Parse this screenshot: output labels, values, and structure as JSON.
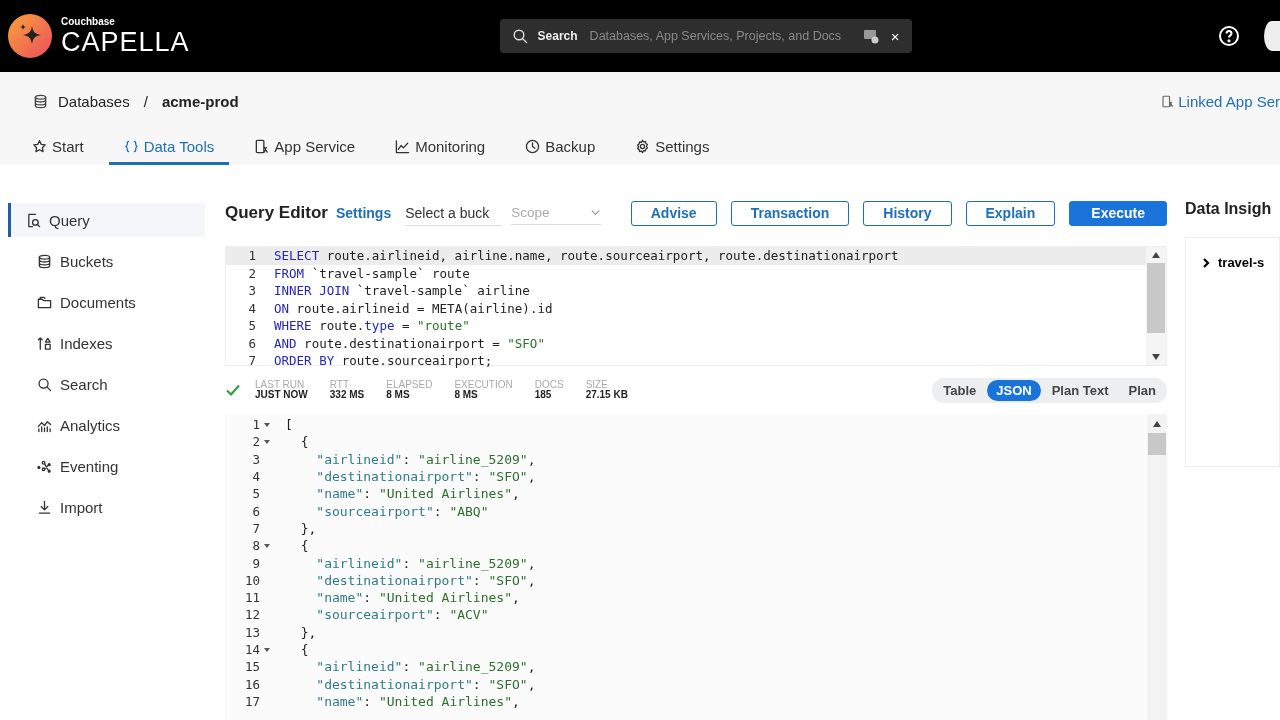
{
  "header": {
    "brand_small": "Couchbase",
    "brand": "CAPELLA",
    "search": {
      "label": "Search",
      "placeholder": "Databases, App Services, Projects, and Docs",
      "close": "×"
    }
  },
  "breadcrumb": {
    "parent": "Databases",
    "separator": "/",
    "current": "acme-prod",
    "link": "Linked App Ser"
  },
  "tabs": [
    {
      "label": "Start",
      "selected": false
    },
    {
      "label": "Data Tools",
      "selected": true
    },
    {
      "label": "App Service",
      "selected": false
    },
    {
      "label": "Monitoring",
      "selected": false
    },
    {
      "label": "Backup",
      "selected": false
    },
    {
      "label": "Settings",
      "selected": false
    }
  ],
  "sidebar": {
    "items": [
      {
        "label": "Query",
        "selected": true
      },
      {
        "label": "Buckets",
        "selected": false
      },
      {
        "label": "Documents",
        "selected": false
      },
      {
        "label": "Indexes",
        "selected": false
      },
      {
        "label": "Search",
        "selected": false
      },
      {
        "label": "Analytics",
        "selected": false
      },
      {
        "label": "Eventing",
        "selected": false
      },
      {
        "label": "Import",
        "selected": false
      }
    ]
  },
  "query_editor": {
    "title": "Query Editor",
    "settings_link": "Settings",
    "bucket_select": "Select a buck",
    "scope_select": "Scope",
    "buttons": [
      {
        "label": "Advise",
        "primary": false
      },
      {
        "label": "Transaction",
        "primary": false
      },
      {
        "label": "History",
        "primary": false
      },
      {
        "label": "Explain",
        "primary": false
      },
      {
        "label": "Execute",
        "primary": true
      }
    ],
    "lines": [
      {
        "number": "1",
        "current": true,
        "tokens": [
          {
            "kind": "keyword",
            "text": "SELECT"
          },
          {
            "kind": "plain",
            "text": " route.airlineid, airline.name, route.sourceairport, route.destinationairport"
          }
        ]
      },
      {
        "number": "2",
        "current": false,
        "tokens": [
          {
            "kind": "keyword",
            "text": "FROM"
          },
          {
            "kind": "plain",
            "text": " `travel-sample` route"
          }
        ]
      },
      {
        "number": "3",
        "current": false,
        "tokens": [
          {
            "kind": "keyword",
            "text": "INNER JOIN"
          },
          {
            "kind": "plain",
            "text": " `travel-sample` airline"
          }
        ]
      },
      {
        "number": "4",
        "current": false,
        "tokens": [
          {
            "kind": "keyword",
            "text": "ON"
          },
          {
            "kind": "plain",
            "text": " route.airlineid = META(airline).id"
          }
        ]
      },
      {
        "number": "5",
        "current": false,
        "tokens": [
          {
            "kind": "keyword",
            "text": "WHERE"
          },
          {
            "kind": "plain",
            "text": " route."
          },
          {
            "kind": "keyword",
            "text": "type"
          },
          {
            "kind": "plain",
            "text": " = "
          },
          {
            "kind": "string",
            "text": "\"route\""
          }
        ]
      },
      {
        "number": "6",
        "current": false,
        "tokens": [
          {
            "kind": "keyword",
            "text": "AND"
          },
          {
            "kind": "plain",
            "text": " route.destinationairport = "
          },
          {
            "kind": "string",
            "text": "\"SFO\""
          }
        ]
      },
      {
        "number": "7",
        "current": false,
        "tokens": [
          {
            "kind": "keyword",
            "text": "ORDER BY"
          },
          {
            "kind": "plain",
            "text": " route.sourceairport;"
          }
        ]
      }
    ]
  },
  "run_status": {
    "success": true,
    "stats": [
      {
        "label": "LAST RUN",
        "value": "JUST NOW"
      },
      {
        "label": "RTT",
        "value": "332 MS"
      },
      {
        "label": "ELAPSED",
        "value": "8 MS"
      },
      {
        "label": "EXECUTION",
        "value": "8 MS"
      },
      {
        "label": "DOCS",
        "value": "185"
      },
      {
        "label": "SIZE",
        "value": "27.15 KB"
      }
    ]
  },
  "view_modes": [
    {
      "label": "Table",
      "selected": false
    },
    {
      "label": "JSON",
      "selected": true
    },
    {
      "label": "Plan Text",
      "selected": false
    },
    {
      "label": "Plan",
      "selected": false
    }
  ],
  "results": {
    "lines": [
      {
        "number": "1",
        "fold": true,
        "tokens": [
          {
            "kind": "plain",
            "text": "["
          }
        ]
      },
      {
        "number": "2",
        "fold": true,
        "tokens": [
          {
            "kind": "plain",
            "text": "  {"
          }
        ]
      },
      {
        "number": "3",
        "fold": false,
        "tokens": [
          {
            "kind": "key",
            "text": "    \"airlineid\""
          },
          {
            "kind": "plain",
            "text": ": "
          },
          {
            "kind": "string",
            "text": "\"airline_5209\""
          },
          {
            "kind": "plain",
            "text": ","
          }
        ]
      },
      {
        "number": "4",
        "fold": false,
        "tokens": [
          {
            "kind": "key",
            "text": "    \"destinationairport\""
          },
          {
            "kind": "plain",
            "text": ": "
          },
          {
            "kind": "string",
            "text": "\"SFO\""
          },
          {
            "kind": "plain",
            "text": ","
          }
        ]
      },
      {
        "number": "5",
        "fold": false,
        "tokens": [
          {
            "kind": "key",
            "text": "    \"name\""
          },
          {
            "kind": "plain",
            "text": ": "
          },
          {
            "kind": "string",
            "text": "\"United Airlines\""
          },
          {
            "kind": "plain",
            "text": ","
          }
        ]
      },
      {
        "number": "6",
        "fold": false,
        "tokens": [
          {
            "kind": "key",
            "text": "    \"sourceairport\""
          },
          {
            "kind": "plain",
            "text": ": "
          },
          {
            "kind": "string",
            "text": "\"ABQ\""
          }
        ]
      },
      {
        "number": "7",
        "fold": false,
        "tokens": [
          {
            "kind": "plain",
            "text": "  },"
          }
        ]
      },
      {
        "number": "8",
        "fold": true,
        "tokens": [
          {
            "kind": "plain",
            "text": "  {"
          }
        ]
      },
      {
        "number": "9",
        "fold": false,
        "tokens": [
          {
            "kind": "key",
            "text": "    \"airlineid\""
          },
          {
            "kind": "plain",
            "text": ": "
          },
          {
            "kind": "string",
            "text": "\"airline_5209\""
          },
          {
            "kind": "plain",
            "text": ","
          }
        ]
      },
      {
        "number": "10",
        "fold": false,
        "tokens": [
          {
            "kind": "key",
            "text": "    \"destinationairport\""
          },
          {
            "kind": "plain",
            "text": ": "
          },
          {
            "kind": "string",
            "text": "\"SFO\""
          },
          {
            "kind": "plain",
            "text": ","
          }
        ]
      },
      {
        "number": "11",
        "fold": false,
        "tokens": [
          {
            "kind": "key",
            "text": "    \"name\""
          },
          {
            "kind": "plain",
            "text": ": "
          },
          {
            "kind": "string",
            "text": "\"United Airlines\""
          },
          {
            "kind": "plain",
            "text": ","
          }
        ]
      },
      {
        "number": "12",
        "fold": false,
        "tokens": [
          {
            "kind": "key",
            "text": "    \"sourceairport\""
          },
          {
            "kind": "plain",
            "text": ": "
          },
          {
            "kind": "string",
            "text": "\"ACV\""
          }
        ]
      },
      {
        "number": "13",
        "fold": false,
        "tokens": [
          {
            "kind": "plain",
            "text": "  },"
          }
        ]
      },
      {
        "number": "14",
        "fold": true,
        "tokens": [
          {
            "kind": "plain",
            "text": "  {"
          }
        ]
      },
      {
        "number": "15",
        "fold": false,
        "tokens": [
          {
            "kind": "key",
            "text": "    \"airlineid\""
          },
          {
            "kind": "plain",
            "text": ": "
          },
          {
            "kind": "string",
            "text": "\"airline_5209\""
          },
          {
            "kind": "plain",
            "text": ","
          }
        ]
      },
      {
        "number": "16",
        "fold": false,
        "tokens": [
          {
            "kind": "key",
            "text": "    \"destinationairport\""
          },
          {
            "kind": "plain",
            "text": ": "
          },
          {
            "kind": "string",
            "text": "\"SFO\""
          },
          {
            "kind": "plain",
            "text": ","
          }
        ]
      },
      {
        "number": "17",
        "fold": false,
        "tokens": [
          {
            "kind": "key",
            "text": "    \"name\""
          },
          {
            "kind": "plain",
            "text": ": "
          },
          {
            "kind": "string",
            "text": "\"United Airlines\""
          },
          {
            "kind": "plain",
            "text": ","
          }
        ]
      }
    ]
  },
  "insights": {
    "title": "Data Insigh",
    "items": [
      {
        "label": "travel-s",
        "expanded": false
      }
    ]
  }
}
